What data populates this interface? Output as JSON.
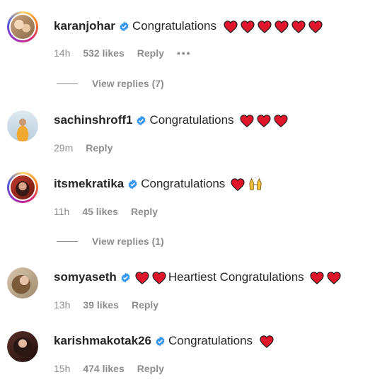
{
  "comments": [
    {
      "username": "karanjohar",
      "text": "Congratulations",
      "hearts_before": 0,
      "hearts_after": 6,
      "time": "14h",
      "likes": "532 likes",
      "reply": "Reply",
      "more": "•••",
      "view_replies": "View replies (7)",
      "story_ring": true
    },
    {
      "username": "sachinshroff1",
      "text": "Congratulations",
      "hearts_before": 0,
      "hearts_after": 3,
      "time": "29m",
      "reply": "Reply",
      "story_ring": false
    },
    {
      "username": "itsmekratika",
      "text": "Congratulations",
      "hearts_before": 0,
      "hearts_after": 1,
      "extra_emoji": "raising-hands-icon",
      "time": "11h",
      "likes": "45 likes",
      "reply": "Reply",
      "view_replies": "View replies (1)",
      "story_ring": true
    },
    {
      "username": "somyaseth",
      "text": "Heartiest Congratulations",
      "hearts_before": 2,
      "hearts_after": 2,
      "time": "13h",
      "likes": "39 likes",
      "reply": "Reply",
      "story_ring": false
    },
    {
      "username": "karishmakotak26",
      "text": "Congratulations",
      "hearts_before": 0,
      "hearts_after": 1,
      "time": "15h",
      "likes": "474 likes",
      "reply": "Reply",
      "story_ring": false
    }
  ],
  "colors": {
    "heart": "#e0142b",
    "verified": "#3897f0",
    "muted": "#8e8e8e"
  }
}
